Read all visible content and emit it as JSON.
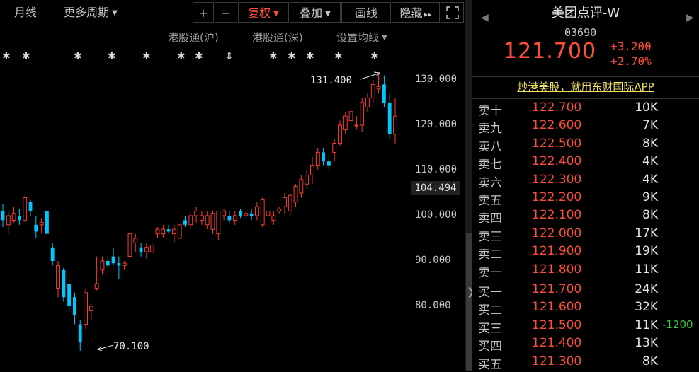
{
  "toolbar": {
    "period_label": "月线",
    "more_periods_label": "更多周期",
    "plus_label": "+",
    "minus_label": "−",
    "adjust_label": "复权",
    "overlay_label": "叠加",
    "draw_label": "画线",
    "hide_label": "隐藏",
    "hide_arrow": "▸▸",
    "fullscreen_icon": "fullscreen-icon"
  },
  "subtoolbar": {
    "sh_connect": "港股通(沪)",
    "sz_connect": "港股通(深)",
    "ma_setting": "设置均线"
  },
  "chart_data": {
    "type": "candlestick",
    "y_ticks": [
      "130.000",
      "120.000",
      "110.000",
      "100.000",
      "90.000",
      "80.000"
    ],
    "current_price_tag": "104.494",
    "max_label": "131.400",
    "min_label": "70.100",
    "colors": {
      "up": "#ff3b30",
      "down": "#00c8ff",
      "bg": "#000000"
    },
    "candles": [
      {
        "o": 101,
        "h": 102.5,
        "l": 97.5,
        "c": 99
      },
      {
        "o": 98,
        "h": 101,
        "l": 96,
        "c": 100
      },
      {
        "o": 99,
        "h": 102,
        "l": 98.5,
        "c": 100.5
      },
      {
        "o": 100,
        "h": 101.5,
        "l": 98,
        "c": 99
      },
      {
        "o": 99,
        "h": 104.5,
        "l": 98.5,
        "c": 104
      },
      {
        "o": 103,
        "h": 103.5,
        "l": 100,
        "c": 101
      },
      {
        "o": 98,
        "h": 100,
        "l": 95,
        "c": 96.5
      },
      {
        "o": 98,
        "h": 99.5,
        "l": 96,
        "c": 98.5
      },
      {
        "o": 101,
        "h": 101.5,
        "l": 95.5,
        "c": 96
      },
      {
        "o": 93,
        "h": 94,
        "l": 89,
        "c": 90
      },
      {
        "o": 84,
        "h": 90,
        "l": 82,
        "c": 89
      },
      {
        "o": 88,
        "h": 88.5,
        "l": 81,
        "c": 82
      },
      {
        "o": 85,
        "h": 86,
        "l": 79,
        "c": 80
      },
      {
        "o": 82,
        "h": 83,
        "l": 76,
        "c": 78
      },
      {
        "o": 76,
        "h": 77,
        "l": 70.1,
        "c": 72
      },
      {
        "o": 76,
        "h": 84,
        "l": 75,
        "c": 83
      },
      {
        "o": 79,
        "h": 80.5,
        "l": 77,
        "c": 80
      },
      {
        "o": 84,
        "h": 91,
        "l": 83.5,
        "c": 85
      },
      {
        "o": 88,
        "h": 91,
        "l": 87,
        "c": 90
      },
      {
        "o": 90,
        "h": 91,
        "l": 88.5,
        "c": 89
      },
      {
        "o": 91,
        "h": 93,
        "l": 89,
        "c": 89.5
      },
      {
        "o": 89.5,
        "h": 91,
        "l": 86,
        "c": 89
      },
      {
        "o": 89,
        "h": 90,
        "l": 88,
        "c": 89.5
      },
      {
        "o": 91,
        "h": 97,
        "l": 90.5,
        "c": 96
      },
      {
        "o": 94,
        "h": 96,
        "l": 92,
        "c": 95
      },
      {
        "o": 93,
        "h": 94,
        "l": 91,
        "c": 92
      },
      {
        "o": 92,
        "h": 94,
        "l": 90.5,
        "c": 93
      },
      {
        "o": 92,
        "h": 94,
        "l": 91.5,
        "c": 93.5
      },
      {
        "o": 96,
        "h": 97.5,
        "l": 95,
        "c": 97
      },
      {
        "o": 96,
        "h": 98,
        "l": 95,
        "c": 97
      },
      {
        "o": 97,
        "h": 98,
        "l": 96,
        "c": 96.5
      },
      {
        "o": 96,
        "h": 98,
        "l": 94,
        "c": 97
      },
      {
        "o": 95,
        "h": 98,
        "l": 95,
        "c": 98
      },
      {
        "o": 99,
        "h": 100,
        "l": 97.5,
        "c": 98
      },
      {
        "o": 98,
        "h": 101,
        "l": 97,
        "c": 100
      },
      {
        "o": 100,
        "h": 102,
        "l": 98.5,
        "c": 101
      },
      {
        "o": 99,
        "h": 101,
        "l": 98,
        "c": 100
      },
      {
        "o": 98,
        "h": 101,
        "l": 97,
        "c": 100
      },
      {
        "o": 97,
        "h": 101,
        "l": 96,
        "c": 100.5
      },
      {
        "o": 96,
        "h": 101,
        "l": 94.5,
        "c": 101
      },
      {
        "o": 100,
        "h": 101.5,
        "l": 99,
        "c": 101
      },
      {
        "o": 100,
        "h": 101,
        "l": 98.5,
        "c": 99
      },
      {
        "o": 99,
        "h": 101,
        "l": 98,
        "c": 100
      },
      {
        "o": 101,
        "h": 101.5,
        "l": 99.5,
        "c": 100
      },
      {
        "o": 100,
        "h": 101,
        "l": 99.5,
        "c": 100.5
      },
      {
        "o": 100.5,
        "h": 101.5,
        "l": 99,
        "c": 100
      },
      {
        "o": 100,
        "h": 103,
        "l": 99,
        "c": 102
      },
      {
        "o": 98,
        "h": 104,
        "l": 97.5,
        "c": 103.5
      },
      {
        "o": 100,
        "h": 102,
        "l": 99,
        "c": 101
      },
      {
        "o": 99,
        "h": 101,
        "l": 98,
        "c": 100
      },
      {
        "o": 101,
        "h": 102,
        "l": 100.5,
        "c": 101.5
      },
      {
        "o": 102,
        "h": 105,
        "l": 100.5,
        "c": 104
      },
      {
        "o": 101,
        "h": 105,
        "l": 100,
        "c": 104.5
      },
      {
        "o": 103,
        "h": 107,
        "l": 102,
        "c": 106.5
      },
      {
        "o": 105,
        "h": 109,
        "l": 104,
        "c": 108
      },
      {
        "o": 107,
        "h": 110,
        "l": 106,
        "c": 109
      },
      {
        "o": 109,
        "h": 113,
        "l": 107,
        "c": 111
      },
      {
        "o": 111,
        "h": 115,
        "l": 110,
        "c": 114
      },
      {
        "o": 114,
        "h": 115,
        "l": 111,
        "c": 112
      },
      {
        "o": 112,
        "h": 113,
        "l": 110,
        "c": 111
      },
      {
        "o": 114,
        "h": 117,
        "l": 112,
        "c": 116
      },
      {
        "o": 116,
        "h": 121,
        "l": 115.5,
        "c": 120
      },
      {
        "o": 119,
        "h": 123,
        "l": 118,
        "c": 122
      },
      {
        "o": 121,
        "h": 124,
        "l": 120,
        "c": 123
      },
      {
        "o": 120,
        "h": 122,
        "l": 119,
        "c": 120
      },
      {
        "o": 120,
        "h": 126,
        "l": 118.5,
        "c": 125
      },
      {
        "o": 124,
        "h": 127,
        "l": 123,
        "c": 126
      },
      {
        "o": 126,
        "h": 130,
        "l": 125,
        "c": 129
      },
      {
        "o": 128,
        "h": 131.4,
        "l": 127,
        "c": 128.5
      },
      {
        "o": 129,
        "h": 131,
        "l": 124,
        "c": 125
      },
      {
        "o": 125,
        "h": 127,
        "l": 117,
        "c": 118
      },
      {
        "o": 118,
        "h": 126,
        "l": 116,
        "c": 122
      }
    ]
  },
  "stars": [
    "✱",
    "✱",
    "✱",
    "✱",
    "✱",
    "✱",
    "✱",
    "⇕",
    "✱",
    "✱",
    "✱",
    "✱",
    "✱"
  ],
  "quote": {
    "name": "美团点评-W",
    "code": "03690",
    "last": "121.700",
    "change": "+3.200",
    "change_pct": "+2.70%",
    "ad_text": "炒港美股，就用东财国际APP",
    "up_color": "#ff4d3a"
  },
  "order_book": {
    "asks": [
      {
        "label": "卖十",
        "price": "122.700",
        "vol": "10K"
      },
      {
        "label": "卖九",
        "price": "122.600",
        "vol": "7K"
      },
      {
        "label": "卖八",
        "price": "122.500",
        "vol": "8K"
      },
      {
        "label": "卖七",
        "price": "122.400",
        "vol": "4K"
      },
      {
        "label": "卖六",
        "price": "122.300",
        "vol": "4K"
      },
      {
        "label": "卖五",
        "price": "122.200",
        "vol": "9K"
      },
      {
        "label": "卖四",
        "price": "122.100",
        "vol": "8K"
      },
      {
        "label": "卖三",
        "price": "122.000",
        "vol": "17K"
      },
      {
        "label": "卖二",
        "price": "121.900",
        "vol": "19K"
      },
      {
        "label": "卖一",
        "price": "121.800",
        "vol": "11K"
      }
    ],
    "bids": [
      {
        "label": "买一",
        "price": "121.700",
        "vol": "24K",
        "delta": ""
      },
      {
        "label": "买二",
        "price": "121.600",
        "vol": "32K",
        "delta": ""
      },
      {
        "label": "买三",
        "price": "121.500",
        "vol": "11K",
        "delta": "-1200"
      },
      {
        "label": "买四",
        "price": "121.400",
        "vol": "13K",
        "delta": ""
      },
      {
        "label": "买五",
        "price": "121.300",
        "vol": "8K",
        "delta": ""
      }
    ]
  }
}
